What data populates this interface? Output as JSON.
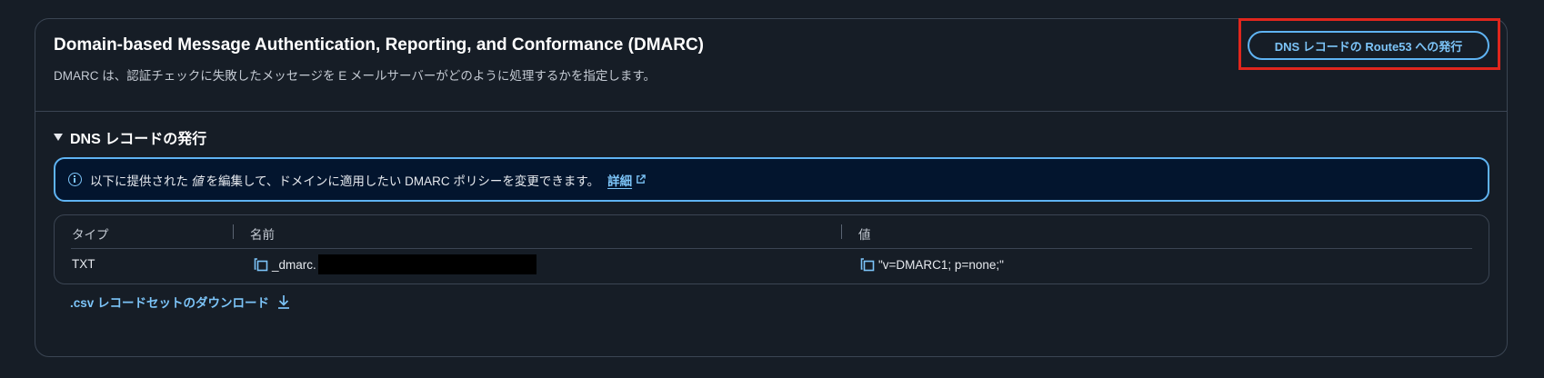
{
  "header": {
    "title": "Domain-based Message Authentication, Reporting, and Conformance (DMARC)",
    "description": "DMARC は、認証チェックに失敗したメッセージを E メールサーバーがどのように処理するかを指定します。",
    "publish_button_label": "DNS レコードの Route53 への発行"
  },
  "section": {
    "title": "DNS レコードの発行",
    "expanded": true
  },
  "info_alert": {
    "text_before": "以下に提供された",
    "text_italic": "値",
    "text_after": "を編集して、ドメインに適用したい DMARC ポリシーを変更できます。",
    "link_label": "詳細",
    "icon": "info-icon"
  },
  "table": {
    "columns": [
      "タイプ",
      "名前",
      "値"
    ],
    "rows": [
      {
        "type": "TXT",
        "name": "_dmarc.",
        "value": "\"v=DMARC1; p=none;\""
      }
    ]
  },
  "download_link_label": ".csv レコードセットのダウンロード",
  "colors": {
    "background": "#161d26",
    "accent": "#7cc4f8",
    "alert_background": "#03152e",
    "highlight": "#e0261d"
  }
}
